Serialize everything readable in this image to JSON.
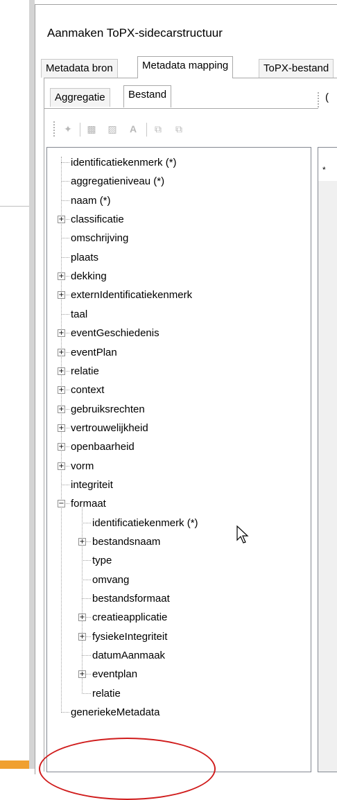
{
  "window": {
    "title": "Aanmaken ToPX-sidecarstructuur"
  },
  "tabs_main": [
    "Metadata bron",
    "Metadata mapping",
    "ToPX-bestand"
  ],
  "tabs_sub": [
    "Aggregatie",
    "Bestand"
  ],
  "toolbar_icons": [
    "select-icon",
    "folder-icon",
    "delete-folder-icon",
    "text-icon",
    "copy-icon",
    "paste-icon"
  ],
  "tree": {
    "root_items": [
      {
        "label": "identificatiekenmerk (*)",
        "expandable": false
      },
      {
        "label": "aggregatieniveau (*)",
        "expandable": false
      },
      {
        "label": "naam (*)",
        "expandable": false
      },
      {
        "label": "classificatie",
        "expandable": true
      },
      {
        "label": "omschrijving",
        "expandable": false
      },
      {
        "label": "plaats",
        "expandable": false
      },
      {
        "label": "dekking",
        "expandable": true
      },
      {
        "label": "externIdentificatiekenmerk",
        "expandable": true
      },
      {
        "label": "taal",
        "expandable": false
      },
      {
        "label": "eventGeschiedenis",
        "expandable": true
      },
      {
        "label": "eventPlan",
        "expandable": true
      },
      {
        "label": "relatie",
        "expandable": true
      },
      {
        "label": "context",
        "expandable": true
      },
      {
        "label": "gebruiksrechten",
        "expandable": true
      },
      {
        "label": "vertrouwelijkheid",
        "expandable": true
      },
      {
        "label": "openbaarheid",
        "expandable": true
      },
      {
        "label": "vorm",
        "expandable": true
      },
      {
        "label": "integriteit",
        "expandable": false
      },
      {
        "label": "formaat",
        "expandable": true,
        "expanded": true
      }
    ],
    "formaat_children": [
      {
        "label": "identificatiekenmerk (*)",
        "expandable": false
      },
      {
        "label": "bestandsnaam",
        "expandable": true
      },
      {
        "label": "type",
        "expandable": false
      },
      {
        "label": "omvang",
        "expandable": false
      },
      {
        "label": "bestandsformaat",
        "expandable": false
      },
      {
        "label": "creatieapplicatie",
        "expandable": true
      },
      {
        "label": "fysiekeIntegriteit",
        "expandable": true
      },
      {
        "label": "datumAanmaak",
        "expandable": false
      },
      {
        "label": "eventplan",
        "expandable": true
      },
      {
        "label": "relatie",
        "expandable": false
      }
    ],
    "last_item": {
      "label": "generiekeMetadata",
      "expandable": false
    }
  },
  "right_pane": {
    "row_marker": "*",
    "header_char": "("
  },
  "annotation": {
    "color": "#d01c1c"
  },
  "colors": {
    "accent_orange": "#f0a030"
  }
}
